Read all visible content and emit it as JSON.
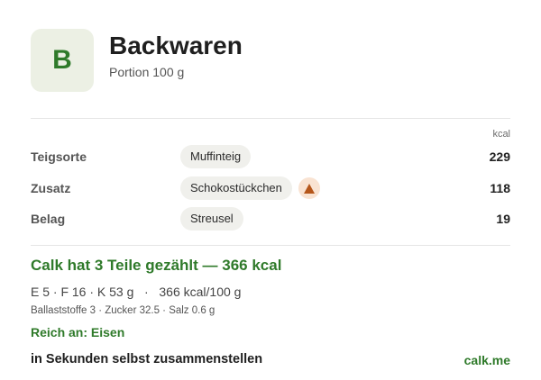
{
  "header": {
    "logo_letter": "B",
    "title": "Backwaren",
    "subtitle": "Portion 100 g"
  },
  "table": {
    "unit_header": "kcal",
    "rows": [
      {
        "label": "Teigsorte",
        "item": "Muffinteig",
        "kcal": "229",
        "warning": false
      },
      {
        "label": "Zusatz",
        "item": "Schokostückchen",
        "kcal": "118",
        "warning": true,
        "warning_icon": "warning-triangle-icon"
      },
      {
        "label": "Belag",
        "item": "Streusel",
        "kcal": "19",
        "warning": false
      }
    ]
  },
  "summary": {
    "headline": "Calk hat 3 Teile gezählt — 366 kcal",
    "macros": "E 5 · F 16 · K 53 g   ·   366 kcal/100 g",
    "micros": "Ballaststoffe 3 · Zucker 32.5 · Salz 0.6 g",
    "rich_in": "Reich an: Eisen"
  },
  "footer": {
    "cta": "in Sekunden selbst zusammenstellen",
    "brand": "calk.me"
  },
  "colors": {
    "accent_green": "#2f7a2a",
    "logo_bg": "#ecf0e4",
    "pill_bg": "#f0f0ec",
    "warning_bg": "#f9e3d2",
    "warning_fg": "#b5561a"
  }
}
